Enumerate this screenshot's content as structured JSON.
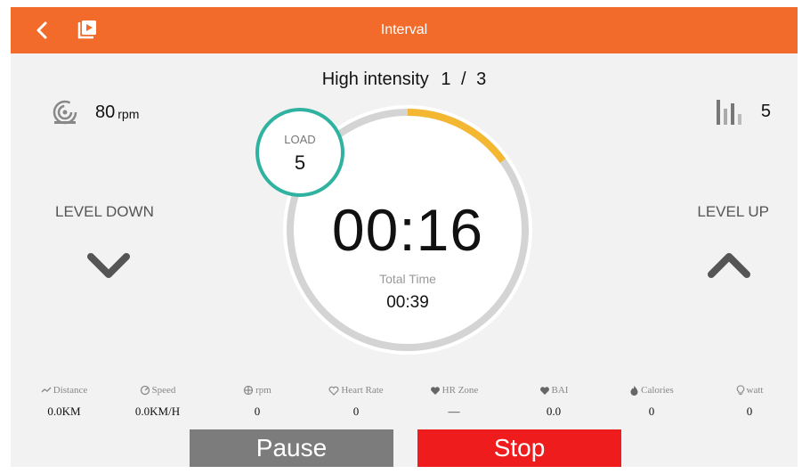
{
  "header": {
    "title": "Interval"
  },
  "segment": {
    "name": "High intensity",
    "current": "1",
    "separator": "/",
    "total": "3"
  },
  "cadence": {
    "value": "80",
    "unit": "rpm"
  },
  "level_indicator": {
    "value": "5"
  },
  "level_down": {
    "label": "LEVEL DOWN"
  },
  "level_up": {
    "label": "LEVEL UP"
  },
  "load": {
    "label": "LOAD",
    "value": "5"
  },
  "timer": {
    "value": "00:16",
    "progress_fraction": 0.15
  },
  "total_time": {
    "label": "Total Time",
    "value": "00:39"
  },
  "stats": [
    {
      "icon": "distance-icon",
      "label": "Distance",
      "value": "0.0KM"
    },
    {
      "icon": "speed-icon",
      "label": "Speed",
      "value": "0.0KM/H"
    },
    {
      "icon": "rpm-icon",
      "label": "rpm",
      "value": "0"
    },
    {
      "icon": "heart-outline-icon",
      "label": "Heart Rate",
      "value": "0"
    },
    {
      "icon": "heart-filled-icon",
      "label": "HR Zone",
      "value": "—"
    },
    {
      "icon": "heart-filled-icon",
      "label": "BAI",
      "value": "0.0"
    },
    {
      "icon": "flame-icon",
      "label": "Calories",
      "value": "0"
    },
    {
      "icon": "bulb-icon",
      "label": "watt",
      "value": "0"
    }
  ],
  "buttons": {
    "pause": "Pause",
    "stop": "Stop"
  },
  "colors": {
    "header": "#f26b2a",
    "progress": "#f4b731",
    "ring": "#d4d4d4",
    "load_ring": "#2fb3a0",
    "pause": "#7c7c7c",
    "stop": "#ee1c1c"
  }
}
